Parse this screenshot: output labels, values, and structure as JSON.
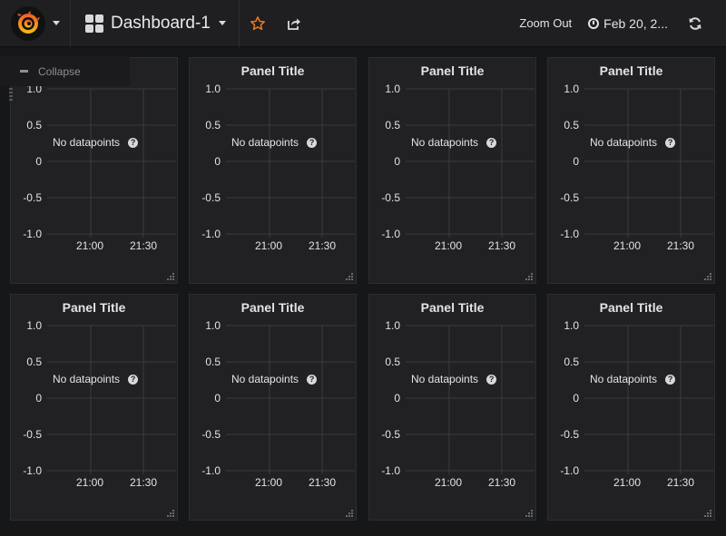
{
  "navbar": {
    "dashboard_title": "Dashboard-1",
    "zoom_out_label": "Zoom Out",
    "time_range_label": "Feb 20, 2...",
    "icons": [
      "grafana-logo",
      "dashboard-grid-icon",
      "star-icon",
      "share-icon",
      "clock-icon",
      "refresh-icon"
    ],
    "star_color": "#eb7b18"
  },
  "row": {
    "collapse_label": "Collapse"
  },
  "panels": [
    {
      "title": "",
      "no_data_text": "No datapoints",
      "help": "?",
      "y_ticks": [
        "1.0",
        "0.5",
        "0",
        "-0.5",
        "-1.0"
      ],
      "x_ticks": [
        "21:00",
        "21:30"
      ]
    },
    {
      "title": "Panel Title",
      "no_data_text": "No datapoints",
      "help": "?",
      "y_ticks": [
        "1.0",
        "0.5",
        "0",
        "-0.5",
        "-1.0"
      ],
      "x_ticks": [
        "21:00",
        "21:30"
      ]
    },
    {
      "title": "Panel Title",
      "no_data_text": "No datapoints",
      "help": "?",
      "y_ticks": [
        "1.0",
        "0.5",
        "0",
        "-0.5",
        "-1.0"
      ],
      "x_ticks": [
        "21:00",
        "21:30"
      ]
    },
    {
      "title": "Panel Title",
      "no_data_text": "No datapoints",
      "help": "?",
      "y_ticks": [
        "1.0",
        "0.5",
        "0",
        "-0.5",
        "-1.0"
      ],
      "x_ticks": [
        "21:00",
        "21:30"
      ]
    },
    {
      "title": "Panel Title",
      "no_data_text": "No datapoints",
      "help": "?",
      "y_ticks": [
        "1.0",
        "0.5",
        "0",
        "-0.5",
        "-1.0"
      ],
      "x_ticks": [
        "21:00",
        "21:30"
      ]
    },
    {
      "title": "Panel Title",
      "no_data_text": "No datapoints",
      "help": "?",
      "y_ticks": [
        "1.0",
        "0.5",
        "0",
        "-0.5",
        "-1.0"
      ],
      "x_ticks": [
        "21:00",
        "21:30"
      ]
    },
    {
      "title": "Panel Title",
      "no_data_text": "No datapoints",
      "help": "?",
      "y_ticks": [
        "1.0",
        "0.5",
        "0",
        "-0.5",
        "-1.0"
      ],
      "x_ticks": [
        "21:00",
        "21:30"
      ]
    },
    {
      "title": "Panel Title",
      "no_data_text": "No datapoints",
      "help": "?",
      "y_ticks": [
        "1.0",
        "0.5",
        "0",
        "-0.5",
        "-1.0"
      ],
      "x_ticks": [
        "21:00",
        "21:30"
      ]
    }
  ],
  "colors": {
    "background": "#161719",
    "panel_bg": "#212124",
    "grid": "#3a3a3c",
    "text": "#e3e3e3"
  }
}
